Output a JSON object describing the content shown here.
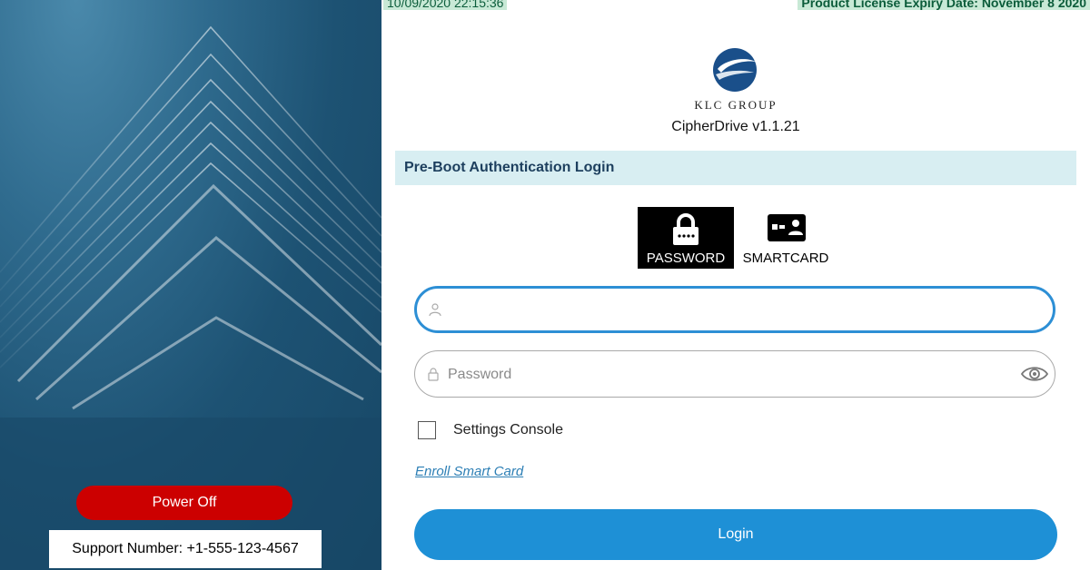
{
  "status_bar": {
    "datetime": "10/09/2020 22:15:36",
    "license": "Product License Expiry Date: November 8 2020"
  },
  "branding": {
    "company": "KLC GROUP",
    "product": "CipherDrive v1.1.21"
  },
  "auth": {
    "header": "Pre-Boot Authentication Login",
    "methods": [
      {
        "label": "PASSWORD",
        "selected": true
      },
      {
        "label": "SMARTCARD",
        "selected": false
      }
    ],
    "username": {
      "value": "",
      "placeholder": ""
    },
    "password": {
      "value": "",
      "placeholder": "Password"
    },
    "settings_console_label": "Settings Console",
    "settings_console_checked": false,
    "enroll_link": "Enroll Smart Card",
    "login_label": "Login"
  },
  "left_panel": {
    "power_off_label": "Power Off",
    "support_text": "Support Number: +1-555-123-4567"
  },
  "colors": {
    "primary": "#1e90d6",
    "danger": "#cc0000",
    "header_bg": "#d8eef2",
    "panel_dark": "#1d5273"
  },
  "icons": {
    "username": "user-icon",
    "password": "lock-icon",
    "reveal": "eye-icon",
    "password_tab": "padlock-icon",
    "smartcard_tab": "smartcard-icon"
  }
}
